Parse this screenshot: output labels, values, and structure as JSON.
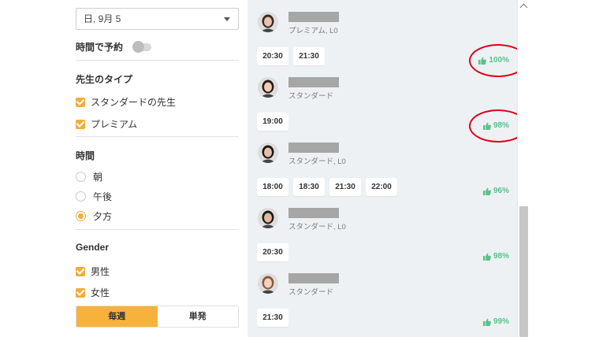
{
  "filters": {
    "date_value": "日, 9月 5",
    "time_booking_label": "時間で予約",
    "teacher_type_heading": "先生のタイプ",
    "teacher_types": [
      {
        "label": "スタンダードの先生",
        "checked": true
      },
      {
        "label": "プレミアム",
        "checked": true
      }
    ],
    "time_heading": "時間",
    "times": [
      {
        "label": "朝",
        "selected": false
      },
      {
        "label": "午後",
        "selected": false
      },
      {
        "label": "夕方",
        "selected": true
      }
    ],
    "gender_heading": "Gender",
    "genders": [
      {
        "label": "男性",
        "checked": true
      },
      {
        "label": "女性",
        "checked": true
      }
    ],
    "frequency": {
      "weekly": "毎週",
      "single": "単発",
      "active": "weekly"
    }
  },
  "teachers": [
    {
      "type_label": "プレミアム, L0",
      "slots": [
        "20:30",
        "21:30"
      ],
      "rating": "100%",
      "highlighted": true
    },
    {
      "type_label": "スタンダード",
      "slots": [
        "19:00"
      ],
      "rating": "98%",
      "highlighted": true
    },
    {
      "type_label": "スタンダード, L0",
      "slots": [
        "18:00",
        "18:30",
        "21:30",
        "22:00"
      ],
      "rating": "96%",
      "highlighted": false
    },
    {
      "type_label": "スタンダード, L0",
      "slots": [
        "20:30"
      ],
      "rating": "98%",
      "highlighted": false
    },
    {
      "type_label": "スタンダード",
      "slots": [
        "21:30"
      ],
      "rating": "99%",
      "highlighted": false
    }
  ],
  "colors": {
    "accent": "#f7b23b",
    "rating_green": "#58c28a",
    "highlight_red": "#e0001a",
    "list_bg": "#eef1f4"
  },
  "icons": {
    "rating": "thumbs-up-icon",
    "dropdown": "chevron-down-icon",
    "scroll_up": "chevron-up-icon"
  }
}
